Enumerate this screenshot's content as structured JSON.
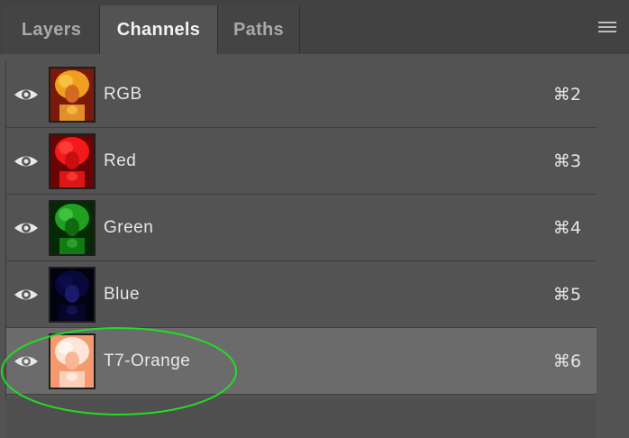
{
  "tabs": [
    {
      "label": "Layers",
      "active": false
    },
    {
      "label": "Channels",
      "active": true
    },
    {
      "label": "Paths",
      "active": false
    }
  ],
  "menu_icon": "hamburger-menu-icon",
  "channels": [
    {
      "name": "RGB",
      "shortcut": "⌘2",
      "visible": true,
      "selected": false,
      "thumb_color": "orange-composite"
    },
    {
      "name": "Red",
      "shortcut": "⌘3",
      "visible": true,
      "selected": false,
      "thumb_color": "#e11d1d"
    },
    {
      "name": "Green",
      "shortcut": "⌘4",
      "visible": true,
      "selected": false,
      "thumb_color": "#1a9a1a"
    },
    {
      "name": "Blue",
      "shortcut": "⌘5",
      "visible": true,
      "selected": false,
      "thumb_color": "#0a0a4a"
    },
    {
      "name": "T7-Orange",
      "shortcut": "⌘6",
      "visible": true,
      "selected": true,
      "thumb_color": "#f6a37c"
    }
  ],
  "annotation": {
    "color": "#22dd22",
    "shape": "ellipse",
    "target": "T7-Orange"
  }
}
